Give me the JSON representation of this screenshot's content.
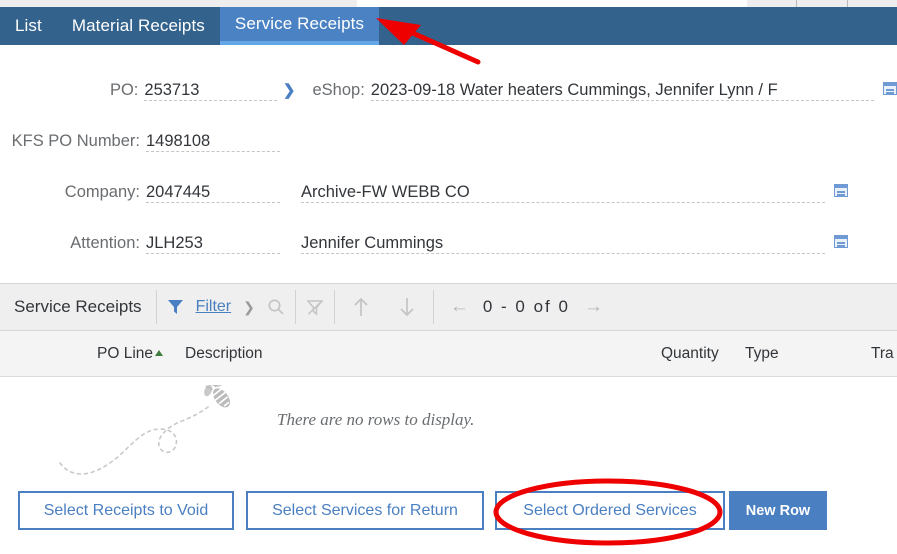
{
  "tabs": [
    {
      "label": "List",
      "active": false
    },
    {
      "label": "Material Receipts",
      "active": false
    },
    {
      "label": "Service Receipts",
      "active": true
    }
  ],
  "form": {
    "po": {
      "label": "PO:",
      "value": "253713"
    },
    "eshop": {
      "label": "eShop:",
      "value": "2023-09-18 Water heaters Cummings, Jennifer Lynn / F"
    },
    "kfs_po_number": {
      "label": "KFS PO Number:",
      "value": "1498108"
    },
    "company": {
      "label": "Company:",
      "value": "2047445",
      "name": "Archive-FW WEBB CO"
    },
    "attention": {
      "label": "Attention:",
      "value": "JLH253",
      "name": "Jennifer Cummings"
    }
  },
  "toolbar": {
    "title": "Service Receipts",
    "filter_label": "Filter",
    "filter_icon": "funnel-icon",
    "chevron_icon": "chevron-right-icon",
    "search_icon": "search-icon",
    "clear_filter_icon": "clear-filter-icon",
    "sort_up_icon": "arrow-up-icon",
    "sort_down_icon": "arrow-down-icon",
    "pager": {
      "prev_icon": "arrow-left-icon",
      "next_icon": "arrow-right-icon",
      "range_text": "0 - 0 of 0"
    }
  },
  "table": {
    "columns": [
      {
        "label": "PO Line",
        "sorted": "asc"
      },
      {
        "label": "Description",
        "sorted": ""
      },
      {
        "label": "Quantity",
        "sorted": ""
      },
      {
        "label": "Type",
        "sorted": ""
      },
      {
        "label": "Tra",
        "sorted": ""
      }
    ],
    "rows": [],
    "empty_message": "There are no rows to display.",
    "empty_illustration": "bee-icon"
  },
  "footer": {
    "buttons": [
      {
        "label": "Select Receipts to Void",
        "style": "ghost"
      },
      {
        "label": "Select Services for Return",
        "style": "ghost"
      },
      {
        "label": "Select Ordered Services",
        "style": "ghost",
        "highlighted": true
      },
      {
        "label": "New Row",
        "style": "primary"
      }
    ]
  },
  "colors": {
    "tabbar_bg": "#33628c",
    "tab_active_bg": "#4a82c4",
    "tab_active_underline": "#63a7e8",
    "accent_blue": "#4a7fc1",
    "annotation_red": "#ee0000",
    "toolbar_bg": "#efefef",
    "table_header_bg": "#f4f4f4",
    "sort_arrow_green": "#3f7d3f"
  },
  "annotations": {
    "arrow": {
      "name": "red-arrow-annotation",
      "points_to": "Service Receipts"
    },
    "ellipse": {
      "name": "red-ellipse-annotation",
      "circles": "Select Ordered Services"
    }
  }
}
